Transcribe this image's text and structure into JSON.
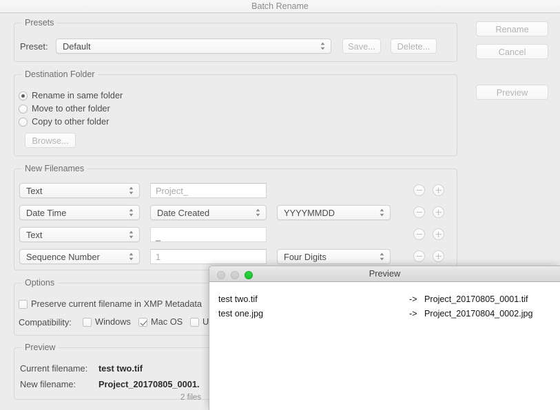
{
  "sheet": {
    "title": "Batch Rename"
  },
  "presets": {
    "group_label": "Presets",
    "preset_label": "Preset:",
    "preset_value": "Default",
    "save_button": "Save...",
    "delete_button": "Delete..."
  },
  "action_buttons": {
    "rename": "Rename",
    "cancel": "Cancel",
    "preview": "Preview"
  },
  "destination": {
    "group_label": "Destination Folder",
    "options": [
      {
        "label": "Rename in same folder",
        "selected": true
      },
      {
        "label": "Move to other folder",
        "selected": false
      },
      {
        "label": "Copy to other folder",
        "selected": false
      }
    ],
    "browse_button": "Browse..."
  },
  "new_filenames": {
    "group_label": "New Filenames",
    "rows": [
      {
        "type": "Text",
        "field_value": "Project_",
        "format": null,
        "minus": "minus-icon",
        "plus": "plus-icon"
      },
      {
        "type": "Date Time",
        "field_value": "Date Created",
        "format": "YYYYMMDD",
        "minus": "minus-icon",
        "plus": "plus-icon"
      },
      {
        "type": "Text",
        "field_value": "_",
        "format": null,
        "minus": "minus-icon",
        "plus": "plus-icon"
      },
      {
        "type": "Sequence Number",
        "field_value": "1",
        "format": "Four Digits",
        "minus": "minus-icon",
        "plus": "plus-icon"
      }
    ]
  },
  "options": {
    "group_label": "Options",
    "preserve_checkbox": {
      "label": "Preserve current filename in XMP Metadata",
      "checked": false
    },
    "compatibility_label": "Compatibility:",
    "compatibility": [
      {
        "label": "Windows",
        "checked": false
      },
      {
        "label": "Mac OS",
        "checked": true
      },
      {
        "label": "U",
        "checked": false
      }
    ]
  },
  "preview_section": {
    "group_label": "Preview",
    "current_label": "Current filename:",
    "current_value": "test two.tif",
    "new_label": "New filename:",
    "new_value": "Project_20170805_0001.",
    "file_count": "2 files"
  },
  "preview_window": {
    "title": "Preview",
    "traffic_lights": [
      "close-button",
      "minimize-button",
      "zoom-button"
    ],
    "rows": [
      {
        "old": "test two.tif",
        "arrow": "->",
        "new": "Project_20170805_0001.tif"
      },
      {
        "old": "test one.jpg",
        "arrow": "->",
        "new": "Project_20170804_0002.jpg"
      }
    ]
  },
  "colors": {
    "background": "#ececec",
    "titlebar": "#f6f6f6",
    "accent_green": "#1fc92f",
    "text": "#4c4c4c",
    "text_dim": "#8e8e8e"
  }
}
